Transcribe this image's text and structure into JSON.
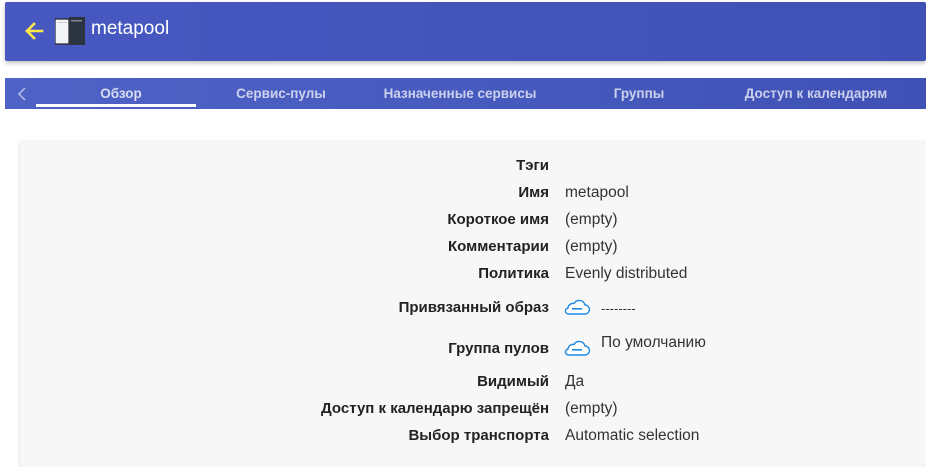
{
  "header": {
    "title": "metapool",
    "back_icon": "arrow-left-icon",
    "app_icon": "pool-icon",
    "back_color": "#ffe94a",
    "bg_color": "#3f51b5"
  },
  "tabs": {
    "prev_icon": "chevron-left-icon",
    "items": [
      {
        "label": "Обзор",
        "active": true
      },
      {
        "label": "Сервис-пулы",
        "active": false
      },
      {
        "label": "Назначенные сервисы",
        "active": false
      },
      {
        "label": "Группы",
        "active": false
      },
      {
        "label": "Доступ к календарям",
        "active": false
      }
    ]
  },
  "details": {
    "rows": [
      {
        "label": "Тэги",
        "value": ""
      },
      {
        "label": "Имя",
        "value": "metapool"
      },
      {
        "label": "Короткое имя",
        "value": "(empty)"
      },
      {
        "label": "Комментарии",
        "value": "(empty)"
      },
      {
        "label": "Политика",
        "value": "Evenly distributed"
      },
      {
        "label": "Привязанный образ",
        "value": "--------",
        "icon": "cloud-icon"
      },
      {
        "label": "Группа пулов",
        "value": "По умолчанию",
        "icon": "cloud-icon"
      },
      {
        "label": "Видимый",
        "value": "Да"
      },
      {
        "label": "Доступ к календарю запрещён",
        "value": "(empty)"
      },
      {
        "label": "Выбор транспорта",
        "value": "Automatic selection"
      }
    ]
  }
}
